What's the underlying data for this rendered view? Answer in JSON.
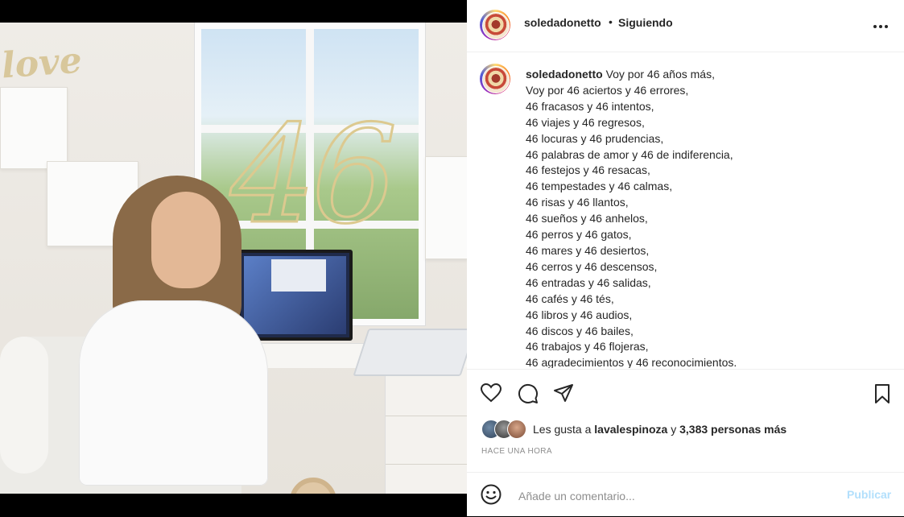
{
  "post": {
    "username": "soledadonetto",
    "follow_dot": "•",
    "follow_status": "Siguiendo",
    "more_icon": "more-horizontal-icon",
    "image_overlay": {
      "word": "love",
      "number": "46"
    },
    "caption": {
      "username": "soledadonetto",
      "lines": [
        "Voy por 46 años más,",
        "Voy por 46 aciertos y 46 errores,",
        "46 fracasos y 46 intentos,",
        "46 viajes y 46 regresos,",
        "46 locuras y 46 prudencias,",
        "46 palabras de amor y 46 de indiferencia,",
        "46 festejos y 46 resacas,",
        "46 tempestades y 46 calmas,",
        "46 risas y 46 llantos,",
        "46 sueños y 46 anhelos,",
        "46 perros y 46 gatos,",
        "46 mares y 46 desiertos,",
        "46 cerros y 46 descensos,",
        "46 entradas y 46 salidas,",
        "46 cafés y 46 tés,",
        "46 libros y 46 audios,",
        "46 discos y 46 bailes,",
        "46 trabajos y 46 flojeras,",
        "46 agradecimientos y 46 reconocimientos."
      ]
    },
    "actions": {
      "like_icon": "heart-icon",
      "comment_icon": "comment-icon",
      "share_icon": "send-icon",
      "save_icon": "bookmark-icon"
    },
    "likes": {
      "prefix": "Les gusta a ",
      "user": "lavalespinoza",
      "middle": " y ",
      "count": "3,383 personas más"
    },
    "timestamp": "HACE UNA HORA",
    "comment": {
      "placeholder": "Añade un comentario...",
      "publish_label": "Publicar",
      "emoji_icon": "emoji-icon"
    }
  },
  "colors": {
    "text": "#262626",
    "muted": "#8e8e8e",
    "publish_disabled": "#b2dffc",
    "divider": "#efefef"
  }
}
